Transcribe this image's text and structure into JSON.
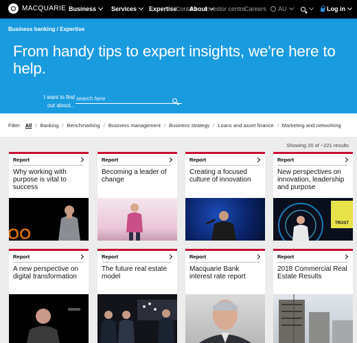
{
  "nav": {
    "brand": "MACQUARIE",
    "items": [
      {
        "label": "Business"
      },
      {
        "label": "Services"
      },
      {
        "label": "Expertise"
      },
      {
        "label": "Contact"
      },
      {
        "label": "About"
      },
      {
        "label": "Investor centre"
      },
      {
        "label": "Careers"
      }
    ],
    "region": "AU",
    "login": "Log in",
    "colors": {
      "bar": "#000000",
      "login_icon": "#2a8fd8"
    }
  },
  "hero": {
    "breadcrumb": "Business banking / Expertise",
    "title": "From handy tips to expert insights, we're here to help.",
    "search_label": "I want to find out about...",
    "search_placeholder": "search here",
    "background": "#1a9be0"
  },
  "filters": {
    "label": "Filter:",
    "items": [
      {
        "label": "All",
        "active": true
      },
      {
        "label": "Banking"
      },
      {
        "label": "Benchmarking"
      },
      {
        "label": "Business management"
      },
      {
        "label": "Business strategy"
      },
      {
        "label": "Loans and asset finance"
      },
      {
        "label": "Marketing and networking"
      }
    ]
  },
  "results": {
    "showing": "Showing 20 of ~221 results"
  },
  "cards": [
    {
      "tag": "Report",
      "title": "Why working with purpose is vital to success",
      "image": "speaker-dark-stage"
    },
    {
      "tag": "Report",
      "title": "Becoming a leader of change",
      "image": "speaker-pink-stage"
    },
    {
      "tag": "Report",
      "title": "Creating a focused culture of innovation",
      "image": "speaker-blue-stage"
    },
    {
      "tag": "Report",
      "title": "New perspectives on innovation, leadership and purpose",
      "image": "speaker-neon-stage"
    },
    {
      "tag": "Report",
      "title": "A new perspective on digital transformation",
      "image": "speaker-dark-portrait"
    },
    {
      "tag": "Report",
      "title": "The future real estate model",
      "image": "panel-discussion"
    },
    {
      "tag": "Report",
      "title": "Macquarie Bank interest rate report",
      "image": "executive-portrait"
    },
    {
      "tag": "Report",
      "title": "2018 Commercial Real Estate Results",
      "image": "city-building"
    }
  ],
  "accent": "#c8102e"
}
